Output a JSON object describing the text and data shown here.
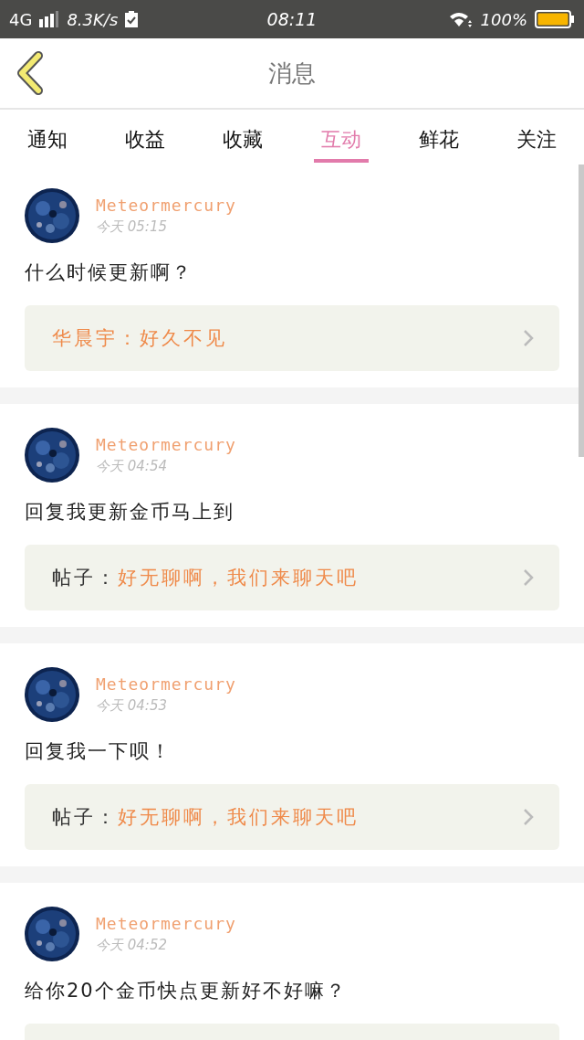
{
  "status_bar": {
    "network": "4G",
    "speed": "8.3K/s",
    "time": "08:11",
    "battery": "100%"
  },
  "header": {
    "title": "消息"
  },
  "tabs": [
    {
      "label": "通知",
      "selected": false
    },
    {
      "label": "收益",
      "selected": false
    },
    {
      "label": "收藏",
      "selected": false
    },
    {
      "label": "互动",
      "selected": true
    },
    {
      "label": "鲜花",
      "selected": false
    },
    {
      "label": "关注",
      "selected": false
    }
  ],
  "messages": [
    {
      "user": "Meteormercury",
      "time": "今天 05:15",
      "text": "什么时候更新啊？",
      "reply": {
        "text": "华晨宇：好久不见"
      }
    },
    {
      "user": "Meteormercury",
      "time": "今天 04:54",
      "text": "回复我更新金币马上到",
      "reply": {
        "label": "帖子：",
        "text": "好无聊啊，我们来聊天吧"
      }
    },
    {
      "user": "Meteormercury",
      "time": "今天 04:53",
      "text": "回复我一下呗！",
      "reply": {
        "label": "帖子：",
        "text": "好无聊啊，我们来聊天吧"
      }
    },
    {
      "user": "Meteormercury",
      "time": "今天 04:52",
      "text": "给你20个金币快点更新好不好嘛？"
    }
  ]
}
